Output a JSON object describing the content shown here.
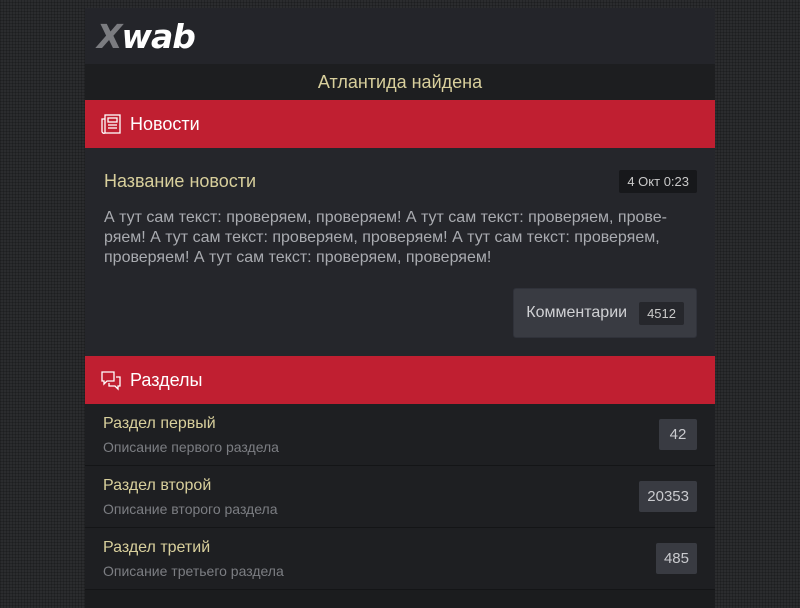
{
  "header": {
    "logo_first": "X",
    "logo_rest": "wab",
    "banner": "Атлантида найдена"
  },
  "news_section": {
    "title": "Новости",
    "icon": "newspaper-icon",
    "item": {
      "title": "Название новости",
      "date": "4 Окт 0:23",
      "text": "А тут сам текст: проверяем, проверяем! А тут сам текст: проверяем, прове­ряем! А тут сам текст: проверяем, проверяем! А тут сам текст: проверяем, проверяем! А тут сам текст: проверяем, проверяем!",
      "comments_label": "Комментарии",
      "comments_count": "4512"
    }
  },
  "sections": {
    "title": "Разделы",
    "icon": "chat-bubbles-icon",
    "items": [
      {
        "name": "Раздел первый",
        "desc": "Описание первого раздела",
        "count": "42"
      },
      {
        "name": "Раздел второй",
        "desc": "Описание второго раздела",
        "count": "20353"
      },
      {
        "name": "Раздел третий",
        "desc": "Описание третьего раздела",
        "count": "485"
      }
    ]
  },
  "colors": {
    "accent": "#c01f31",
    "title_gold": "#d8cf9c",
    "panel": "#25262b",
    "dark": "#1e1f22"
  }
}
